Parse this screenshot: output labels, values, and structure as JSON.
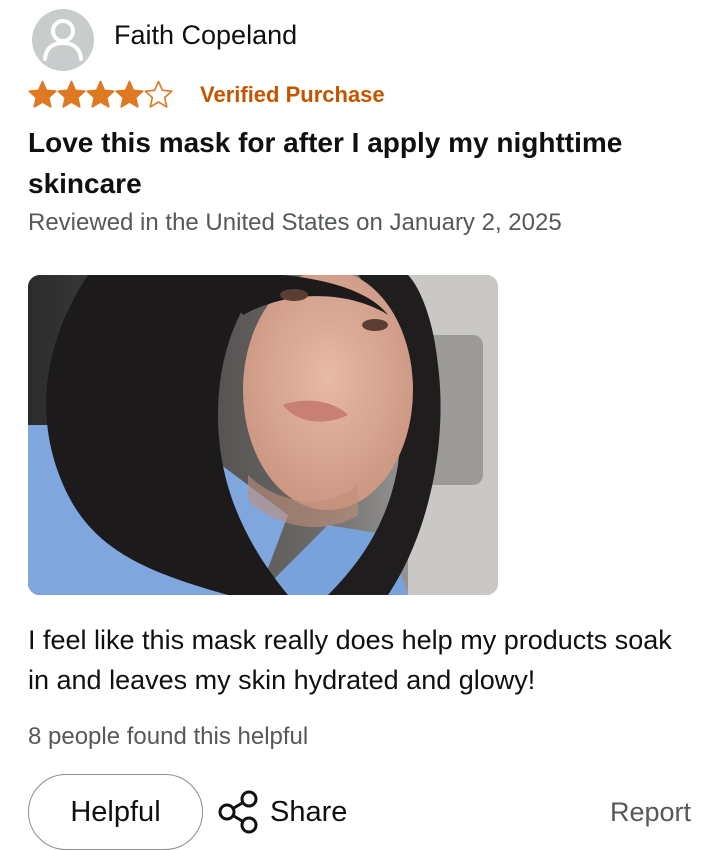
{
  "reviewer": {
    "name": "Faith Copeland",
    "avatar_icon": "user-silhouette-icon"
  },
  "rating": {
    "stars_filled": 4,
    "stars_total": 5,
    "star_color": "#de7921"
  },
  "badge": {
    "label": "Verified Purchase",
    "color": "#c45500"
  },
  "review": {
    "title": "Love this mask for after I apply my nighttime skincare",
    "date": "Reviewed in the United States on January 2, 2025",
    "body": "I feel like this mask really does help my products soak in and leaves my skin hydrated and glowy!"
  },
  "helpful": {
    "count_text": "8 people found this helpful",
    "button_label": "Helpful"
  },
  "actions": {
    "share_label": "Share",
    "share_icon": "share-icon",
    "report_label": "Report"
  }
}
